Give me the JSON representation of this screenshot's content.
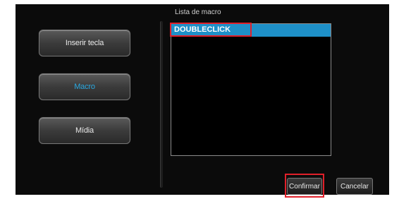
{
  "sidebar": {
    "items": [
      {
        "label": "Inserir tecla"
      },
      {
        "label": "Macro"
      },
      {
        "label": "Mídia"
      }
    ]
  },
  "macro_list": {
    "title": "Lista de macro",
    "items": [
      "DOUBLECLICK"
    ],
    "selected": "DOUBLECLICK"
  },
  "footer": {
    "confirm_label": "Confirmar",
    "cancel_label": "Cancelar"
  },
  "colors": {
    "selection": "#1e90c8",
    "active_text": "#2aa8e0",
    "highlight": "#e0202a"
  }
}
